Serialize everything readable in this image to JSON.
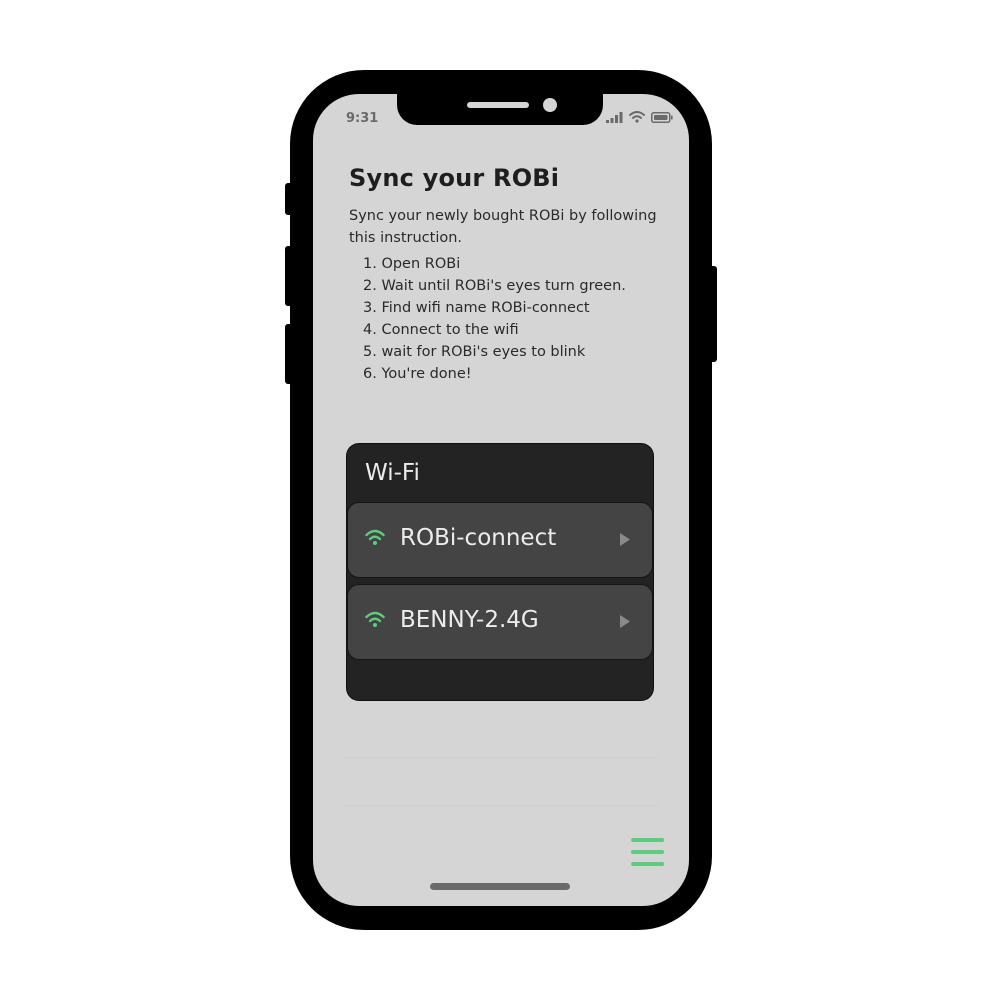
{
  "status_bar": {
    "time": "9:31"
  },
  "page": {
    "title": "Sync your ROBi",
    "intro": "Sync your newly bought ROBi by following this instruction.",
    "steps": [
      "1. Open ROBi",
      "2. Wait until ROBi's eyes turn green.",
      "3. Find wifi name ROBi-connect",
      "4. Connect to the wifi",
      "5. wait for ROBi's eyes to blink",
      "6. You're done!"
    ]
  },
  "wifi": {
    "title": "Wi-Fi",
    "networks": [
      {
        "name": "ROBi-connect",
        "icon": "wifi-icon"
      },
      {
        "name": "BENNY-2.4G",
        "icon": "wifi-icon"
      }
    ]
  },
  "icons": {
    "menu": "hamburger-menu-icon",
    "network_arrow": "play-triangle-icon"
  },
  "colors": {
    "accent": "#5ccc7d",
    "screen_bg": "#d5d5d5",
    "panel_bg": "#232323",
    "row_bg": "#444444"
  }
}
